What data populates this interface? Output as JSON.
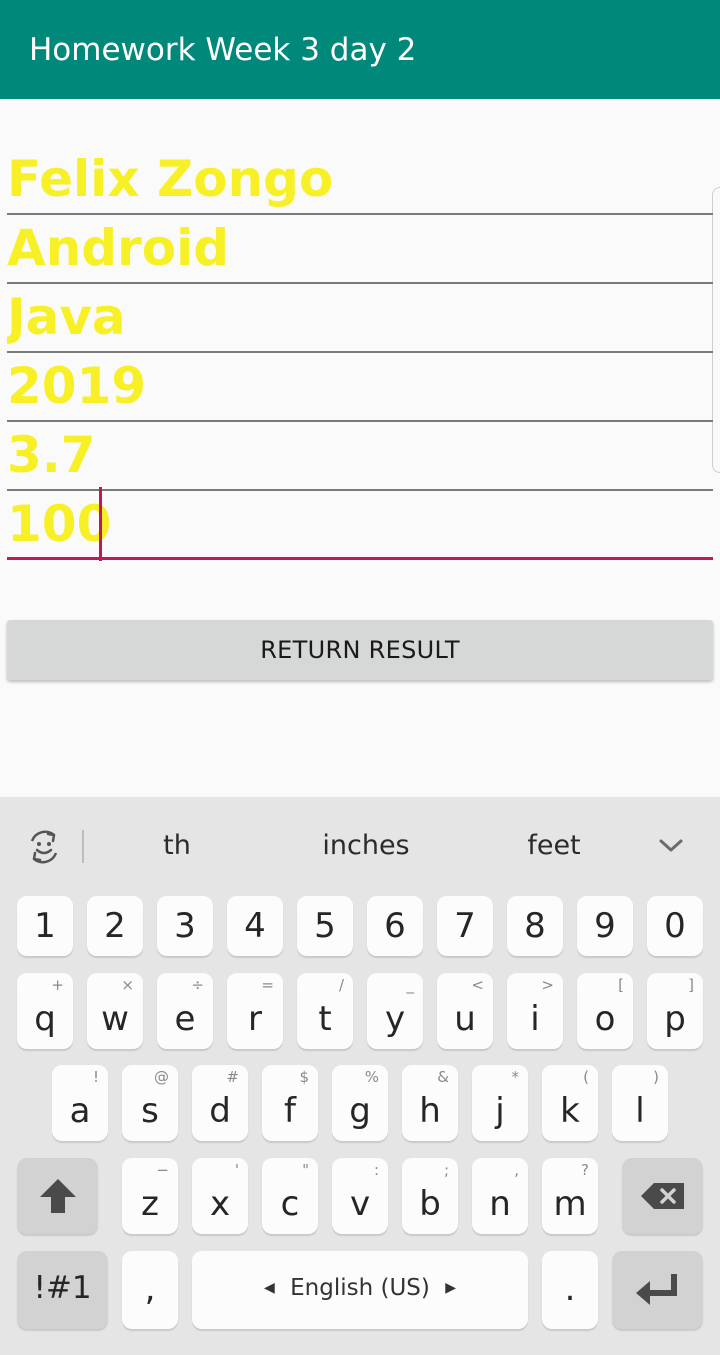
{
  "appbar": {
    "title": "Homework Week 3 day 2"
  },
  "form": {
    "fields": [
      {
        "value": "Felix Zongo"
      },
      {
        "value": "Android"
      },
      {
        "value": "Java"
      },
      {
        "value": "2019"
      },
      {
        "value": "3.7"
      },
      {
        "value": "100"
      }
    ],
    "return_button": "RETURN RESULT"
  },
  "colors": {
    "appbar": "#00897b",
    "text_yellow": "#f7f027",
    "accent": "#c2185b",
    "button": "#d6d7d7"
  },
  "keyboard": {
    "suggestions": [
      "th",
      "inches",
      "feet"
    ],
    "row_numbers": [
      "1",
      "2",
      "3",
      "4",
      "5",
      "6",
      "7",
      "8",
      "9",
      "0"
    ],
    "row1": {
      "keys": [
        "q",
        "w",
        "e",
        "r",
        "t",
        "y",
        "u",
        "i",
        "o",
        "p"
      ],
      "hints": [
        "+",
        "×",
        "÷",
        "=",
        "/",
        "_",
        "<",
        ">",
        "[",
        "]"
      ]
    },
    "row2": {
      "keys": [
        "a",
        "s",
        "d",
        "f",
        "g",
        "h",
        "j",
        "k",
        "l"
      ],
      "hints": [
        "!",
        "@",
        "#",
        "$",
        "%",
        "&",
        "*",
        "(",
        ")"
      ]
    },
    "row3": {
      "keys": [
        "z",
        "x",
        "c",
        "v",
        "b",
        "n",
        "m"
      ],
      "hints": [
        "−",
        "'",
        "\"",
        ":",
        ";",
        ",",
        "?"
      ]
    },
    "symbols_key": "!#1",
    "comma_key": ",",
    "space_label": "English (US)",
    "period_key": ".",
    "icons": {
      "emoji_toggle": "emoji-toggle-icon",
      "expand": "chevron-down-icon",
      "shift": "shift-arrow-icon",
      "backspace": "backspace-icon",
      "enter": "enter-icon"
    }
  }
}
